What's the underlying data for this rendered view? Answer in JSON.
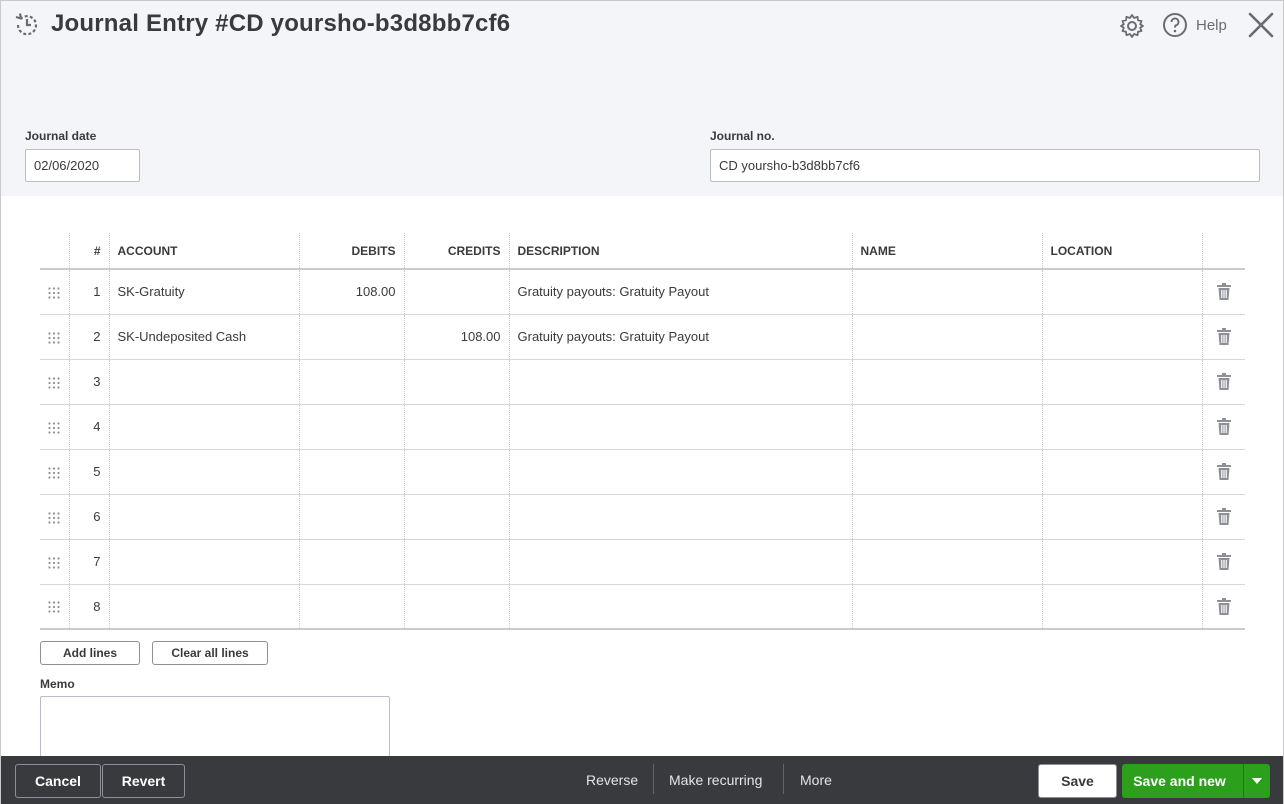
{
  "header": {
    "title": "Journal Entry #CD yoursho-b3d8bb7cf6",
    "help_label": "Help"
  },
  "form": {
    "journal_date_label": "Journal date",
    "journal_date_value": "02/06/2020",
    "journal_no_label": "Journal no.",
    "journal_no_value": "CD yoursho-b3d8bb7cf6"
  },
  "table": {
    "columns": [
      "#",
      "ACCOUNT",
      "DEBITS",
      "CREDITS",
      "DESCRIPTION",
      "NAME",
      "LOCATION"
    ],
    "rows": [
      {
        "num": "1",
        "account": "SK-Gratuity",
        "debits": "108.00",
        "credits": "",
        "description": "Gratuity payouts: Gratuity Payout",
        "name": "",
        "location": ""
      },
      {
        "num": "2",
        "account": "SK-Undeposited Cash",
        "debits": "",
        "credits": "108.00",
        "description": "Gratuity payouts: Gratuity Payout",
        "name": "",
        "location": ""
      },
      {
        "num": "3",
        "account": "",
        "debits": "",
        "credits": "",
        "description": "",
        "name": "",
        "location": ""
      },
      {
        "num": "4",
        "account": "",
        "debits": "",
        "credits": "",
        "description": "",
        "name": "",
        "location": ""
      },
      {
        "num": "5",
        "account": "",
        "debits": "",
        "credits": "",
        "description": "",
        "name": "",
        "location": ""
      },
      {
        "num": "6",
        "account": "",
        "debits": "",
        "credits": "",
        "description": "",
        "name": "",
        "location": ""
      },
      {
        "num": "7",
        "account": "",
        "debits": "",
        "credits": "",
        "description": "",
        "name": "",
        "location": ""
      },
      {
        "num": "8",
        "account": "",
        "debits": "",
        "credits": "",
        "description": "",
        "name": "",
        "location": ""
      }
    ]
  },
  "actions": {
    "add_lines": "Add lines",
    "clear_all_lines": "Clear all lines",
    "memo_label": "Memo"
  },
  "footer": {
    "cancel": "Cancel",
    "revert": "Revert",
    "reverse": "Reverse",
    "make_recurring": "Make recurring",
    "more": "More",
    "save": "Save",
    "save_and_new": "Save and new"
  },
  "colors": {
    "brand_green": "#2ca01c",
    "footer_bg": "#393a3d",
    "header_bg": "#f4f5f8"
  }
}
